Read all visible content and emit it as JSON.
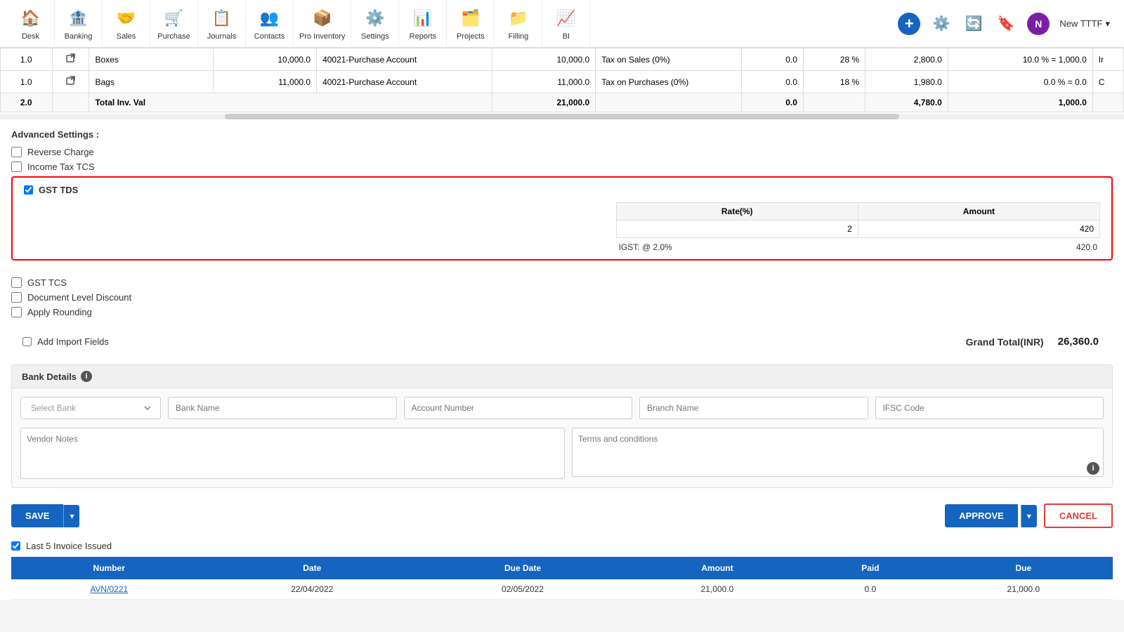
{
  "nav": {
    "items": [
      {
        "label": "Desk",
        "icon": "🏠"
      },
      {
        "label": "Banking",
        "icon": "🏦"
      },
      {
        "label": "Sales",
        "icon": "🤝"
      },
      {
        "label": "Purchase",
        "icon": "🛒"
      },
      {
        "label": "Journals",
        "icon": "📋"
      },
      {
        "label": "Contacts",
        "icon": "👥"
      },
      {
        "label": "Pro Inventory",
        "icon": "📦"
      },
      {
        "label": "Settings",
        "icon": "⚙️"
      },
      {
        "label": "Reports",
        "icon": "📊"
      },
      {
        "label": "Projects",
        "icon": "🗂️"
      },
      {
        "label": "Filling",
        "icon": "📁"
      },
      {
        "label": "BI",
        "icon": "📈"
      }
    ],
    "user": "New TTTF"
  },
  "table": {
    "rows": [
      {
        "qty": "1.0",
        "name": "Boxes",
        "amount": "10,000.0",
        "account": "40021-Purchase Account",
        "inv_val": "10,000.0",
        "tax_name": "Tax on Sales (0%)",
        "tax_val": "0.0",
        "tax_pct": "28 %",
        "tax_amt": "2,800.0",
        "disc": "10.0 % = 1,000.0",
        "extra": "Ir"
      },
      {
        "qty": "1.0",
        "name": "Bags",
        "amount": "11,000.0",
        "account": "40021-Purchase Account",
        "inv_val": "11,000.0",
        "tax_name": "Tax on Purchases (0%)",
        "tax_val": "0.0",
        "tax_pct": "18 %",
        "tax_amt": "1,980.0",
        "disc": "0.0 % = 0.0",
        "extra": "C"
      }
    ],
    "total_row": {
      "qty": "2.0",
      "label": "Total Inv. Val",
      "inv_val": "21,000.0",
      "tax_val": "0.0",
      "tax_amt": "4,780.0",
      "disc": "1,000.0"
    }
  },
  "advanced_settings": {
    "title": "Advanced Settings :",
    "checkboxes": [
      {
        "label": "Reverse Charge",
        "checked": false
      },
      {
        "label": "Income Tax TCS",
        "checked": false
      }
    ]
  },
  "gst_tds": {
    "label": "GST TDS",
    "checked": true,
    "rate_label": "Rate(%)",
    "amount_label": "Amount",
    "rate_value": "2",
    "amount_value": "420",
    "igst_label": "IGST: @ 2.0%",
    "igst_value": "420.0"
  },
  "more_checkboxes": [
    {
      "label": "GST TCS",
      "checked": false
    },
    {
      "label": "Document Level Discount",
      "checked": false
    },
    {
      "label": "Apply Rounding",
      "checked": false
    }
  ],
  "add_import": {
    "label": "Add Import Fields",
    "checked": false
  },
  "grand_total": {
    "label": "Grand Total(INR)",
    "value": "26,360.0"
  },
  "bank_details": {
    "title": "Bank Details",
    "select_bank_placeholder": "Select Bank",
    "bank_name_placeholder": "Bank Name",
    "account_number_placeholder": "Account Number",
    "branch_name_placeholder": "Branch Name",
    "ifsc_placeholder": "IFSC Code",
    "vendor_notes_placeholder": "Vendor Notes",
    "terms_placeholder": "Terms and conditions"
  },
  "buttons": {
    "save": "SAVE",
    "approve": "APPROVE",
    "cancel": "CANCEL"
  },
  "last_invoice": {
    "label": "Last 5 Invoice Issued",
    "checked": true,
    "columns": [
      "Number",
      "Date",
      "Due Date",
      "Amount",
      "Paid",
      "Due"
    ],
    "rows": [
      {
        "number": "AVN/0221",
        "date": "22/04/2022",
        "due_date": "02/05/2022",
        "amount": "21,000.0",
        "paid": "0.0",
        "due": "21,000.0"
      }
    ]
  }
}
